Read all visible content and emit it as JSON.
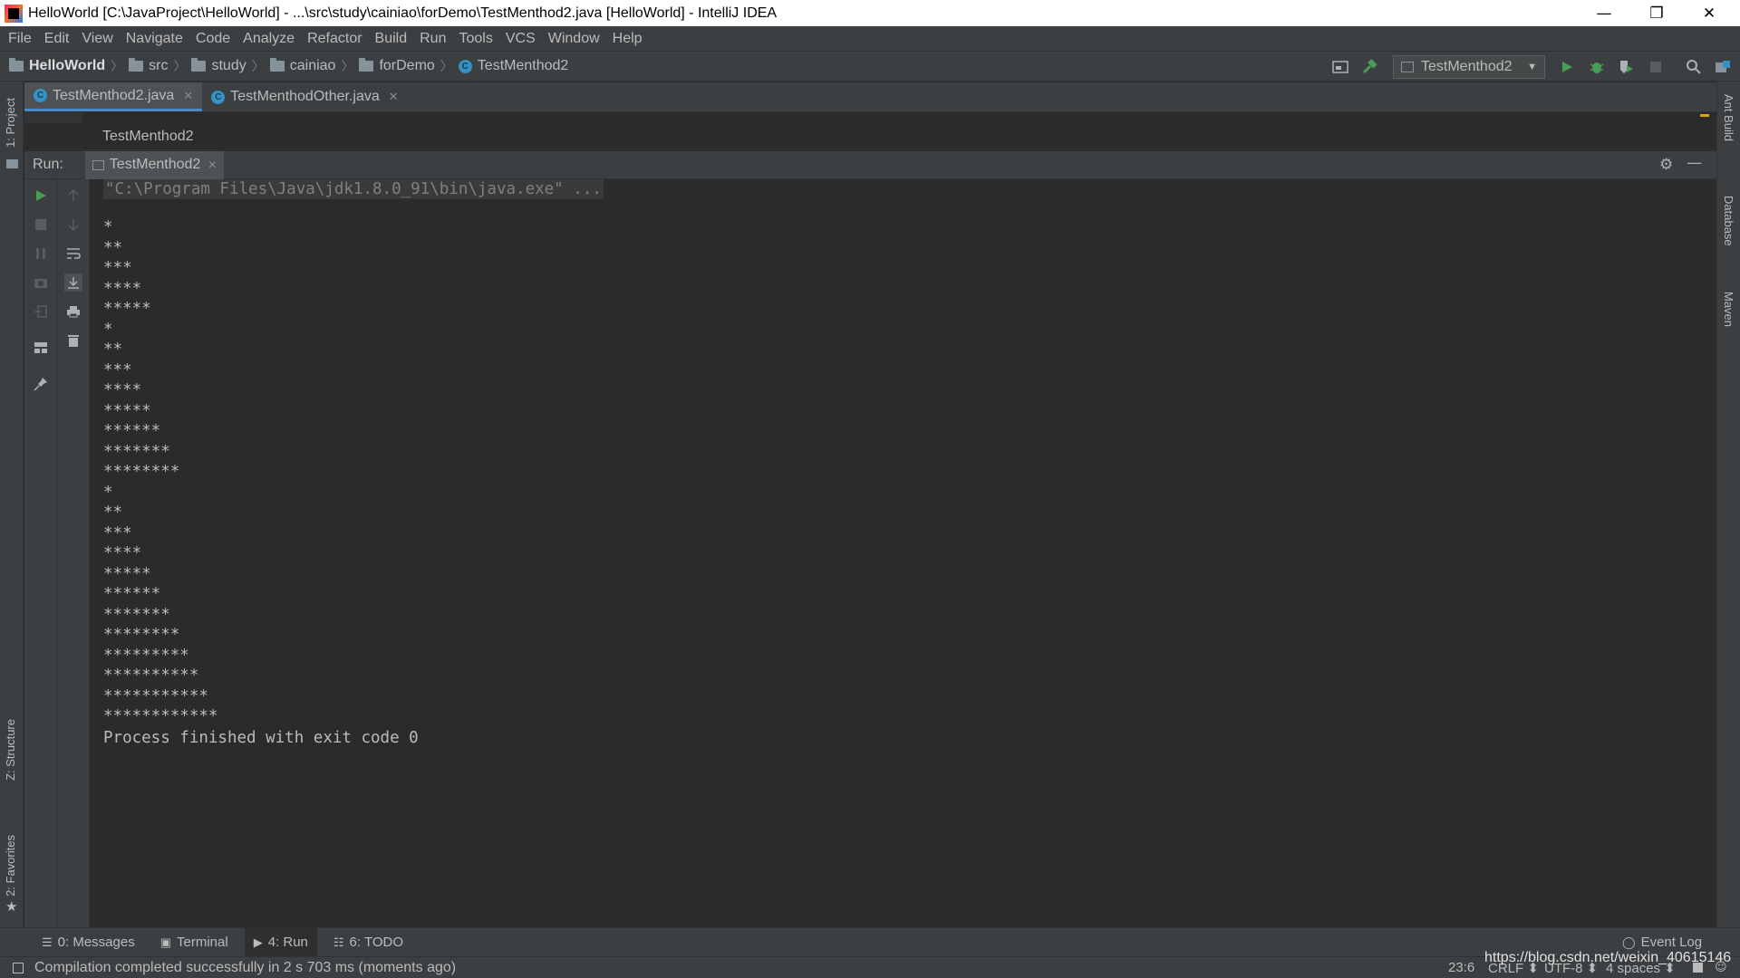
{
  "window": {
    "title": "HelloWorld [C:\\JavaProject\\HelloWorld] - ...\\src\\study\\cainiao\\forDemo\\TestMenthod2.java [HelloWorld] - IntelliJ IDEA",
    "minimize": "—",
    "maximize": "❐",
    "close": "✕"
  },
  "menu": [
    "File",
    "Edit",
    "View",
    "Navigate",
    "Code",
    "Analyze",
    "Refactor",
    "Build",
    "Run",
    "Tools",
    "VCS",
    "Window",
    "Help"
  ],
  "breadcrumbs": [
    "HelloWorld",
    "src",
    "study",
    "cainiao",
    "forDemo",
    "TestMenthod2"
  ],
  "run_config": "TestMenthod2",
  "editor_tabs": [
    {
      "label": "TestMenthod2.java",
      "active": true
    },
    {
      "label": "TestMenthodOther.java",
      "active": false
    }
  ],
  "editor_breadcrumb": "TestMenthod2",
  "run_panel": {
    "label": "Run:",
    "tab": "TestMenthod2"
  },
  "console": {
    "command": "\"C:\\Program Files\\Java\\jdk1.8.0_91\\bin\\java.exe\" ...",
    "lines": [
      "*",
      "**",
      "***",
      "****",
      "*****",
      "*",
      "**",
      "***",
      "****",
      "*****",
      "******",
      "*******",
      "********",
      "*",
      "**",
      "***",
      "****",
      "*****",
      "******",
      "*******",
      "********",
      "*********",
      "**********",
      "***********",
      "************"
    ],
    "exit": "Process finished with exit code 0"
  },
  "left_stripe": {
    "project": "1: Project",
    "structure": "Z: Structure",
    "favorites": "2: Favorites"
  },
  "right_stripe": {
    "ant": "Ant Build",
    "database": "Database",
    "maven": "Maven"
  },
  "bottom_tabs": [
    {
      "label": "0: Messages",
      "icon": "messages-icon",
      "active": false
    },
    {
      "label": "Terminal",
      "icon": "terminal-icon",
      "active": false
    },
    {
      "label": "4: Run",
      "icon": "run-icon",
      "active": true
    },
    {
      "label": "6: TODO",
      "icon": "todo-icon",
      "active": false
    }
  ],
  "event_log": "Event Log",
  "status": {
    "message": "Compilation completed successfully in 2 s 703 ms (moments ago)",
    "position": "23:6",
    "line_sep": "CRLF ⬍",
    "encoding": "UTF-8 ⬍",
    "indent": "4 spaces ⬍"
  },
  "watermark": "https://blog.csdn.net/weixin_40615146",
  "colors": {
    "accent": "#4a88c7",
    "run_green": "#499c54",
    "bg": "#2b2b2b",
    "panel": "#3c3f41"
  }
}
